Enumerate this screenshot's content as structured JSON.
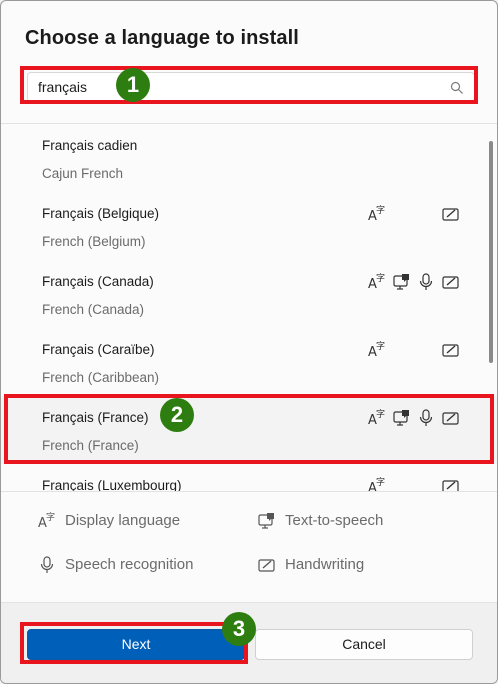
{
  "dialog": {
    "title": "Choose a language to install"
  },
  "search": {
    "value": "français",
    "placeholder": ""
  },
  "languages": [
    {
      "native": "Français cadien",
      "english": "Cajun French",
      "features": []
    },
    {
      "native": "Français (Belgique)",
      "english": "French (Belgium)",
      "features": [
        "display-language",
        "handwriting"
      ]
    },
    {
      "native": "Français (Canada)",
      "english": "French (Canada)",
      "features": [
        "display-language",
        "text-to-speech",
        "speech-recognition",
        "handwriting"
      ]
    },
    {
      "native": "Français (Caraïbe)",
      "english": "French (Caribbean)",
      "features": [
        "display-language",
        "handwriting"
      ]
    },
    {
      "native": "Français (France)",
      "english": "French (France)",
      "features": [
        "display-language",
        "text-to-speech",
        "speech-recognition",
        "handwriting"
      ],
      "selected": true
    },
    {
      "native": "Français (Luxembourg)",
      "english": "",
      "features": [
        "display-language",
        "handwriting"
      ]
    }
  ],
  "legend": {
    "display_language": "Display language",
    "text_to_speech": "Text-to-speech",
    "speech_recognition": "Speech recognition",
    "handwriting": "Handwriting"
  },
  "buttons": {
    "next": "Next",
    "cancel": "Cancel"
  },
  "annotations": {
    "badge_1": "1",
    "badge_2": "2",
    "badge_3": "3",
    "highlight_color": "#e8141e",
    "badge_color": "#2e7d10"
  },
  "colors": {
    "accent": "#005fb8"
  }
}
